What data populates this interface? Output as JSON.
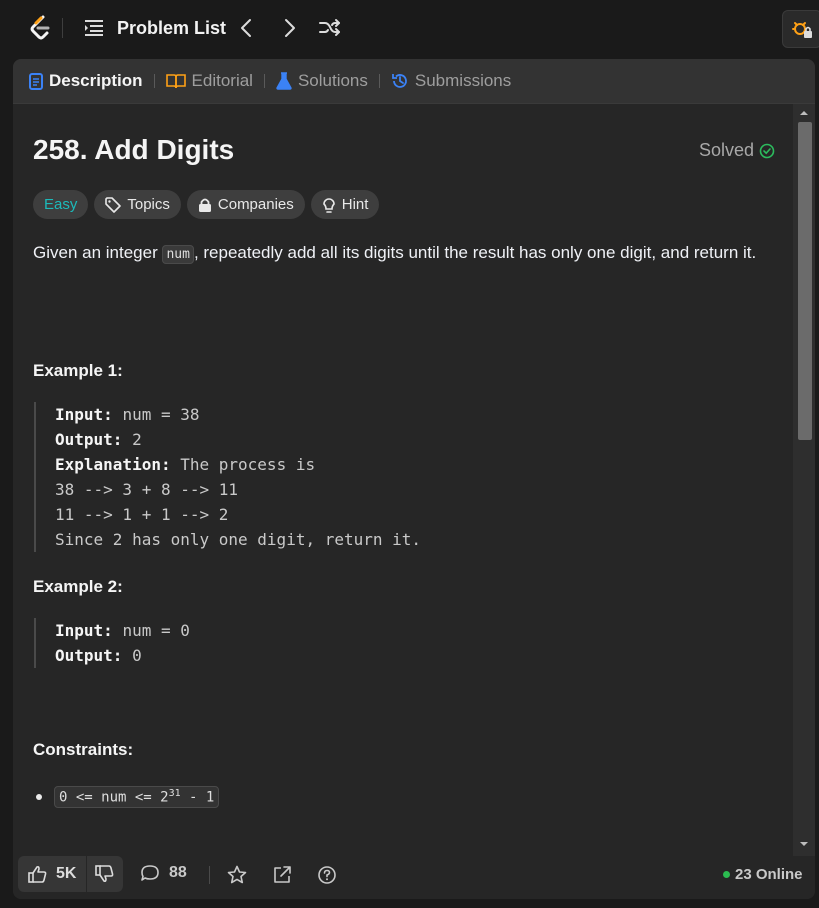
{
  "topbar": {
    "title": "Problem List"
  },
  "tabs": {
    "description": "Description",
    "editorial": "Editorial",
    "solutions": "Solutions",
    "submissions": "Submissions"
  },
  "problem": {
    "title": "258. Add Digits",
    "status": "Solved",
    "difficulty": "Easy",
    "topics": "Topics",
    "companies": "Companies",
    "hint": "Hint",
    "desc_before": "Given an integer ",
    "desc_code": "num",
    "desc_after": ", repeatedly add all its digits until the result has only one digit, and return it."
  },
  "example1": {
    "heading": "Example 1:",
    "input_label": "Input:",
    "input_value": "num = 38",
    "output_label": "Output:",
    "output_value": "2",
    "explanation_label": "Explanation:",
    "explanation_value": "The process is",
    "line1": "38 --> 3 + 8 --> 11",
    "line2": "11 --> 1 + 1 --> 2",
    "line3": "Since 2 has only one digit, return it."
  },
  "example2": {
    "heading": "Example 2:",
    "input_label": "Input:",
    "input_value": "num = 0",
    "output_label": "Output:",
    "output_value": "0"
  },
  "constraints": {
    "heading": "Constraints:",
    "c1_before": "0 <= num <= 2",
    "c1_sup": "31",
    "c1_after": " - 1"
  },
  "bottombar": {
    "likes": "5K",
    "comments": "88",
    "online": "23 Online"
  },
  "colors": {
    "accent_easy": "#1cbaba",
    "solved_green": "#2cbb5d",
    "online_dot": "#2bbb50"
  }
}
